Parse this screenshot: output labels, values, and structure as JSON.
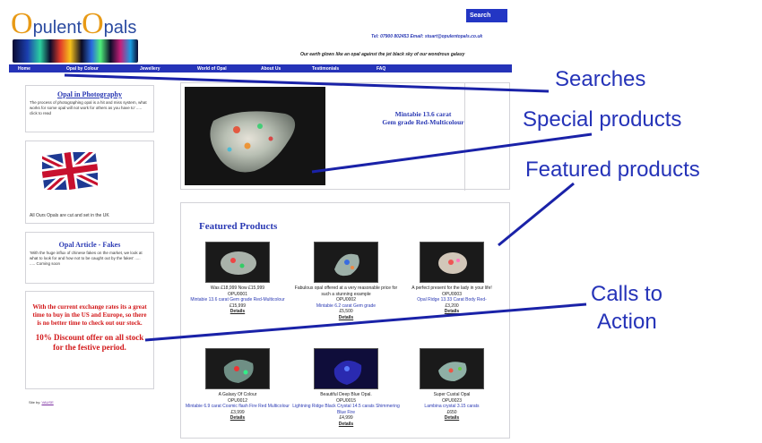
{
  "header": {
    "logo_text_1": "O",
    "logo_text_2": "pulent",
    "logo_text_3": "O",
    "logo_text_4": "pals",
    "search_label": "Search",
    "contact": "Tel: 07900 802453  Email: stuart@opulentopals.co.uk",
    "tagline": "Our earth glows like an opal against the jet black sky of our wondrous galaxy"
  },
  "nav": {
    "items": [
      "Home",
      "Opal by Colour",
      "Jewellery",
      "World of Opal",
      "About Us",
      "Testimonials",
      "FAQ"
    ]
  },
  "sidebar": {
    "photo_title": "Opal in Photography",
    "photo_text": "The process of photographing opal is a hit and miss system, what works for some opal will not work for others as you have to' ..... click to read",
    "flag_caption": "All Ours Opals are cut  and set in the UK",
    "article_title": "Opal Article - Fakes",
    "article_text": "'With the huge influx of chinese fakes on the market, we look at what to look for and how not to be caught out by the fakes' .....",
    "article_more": "..... Coming soon",
    "promo_text": "With the current exchange rates its a great time to buy in the US and Europe, so there is no better time to check out our stock.",
    "promo_offer": "10% Discount offer on all stock for the festive period.",
    "site_by_label": "Site by:",
    "site_by_link": "VAUSE"
  },
  "special": {
    "title_line_1": "Mintabie 13.6 carat",
    "title_line_2": "Gem grade Red-Multicolour"
  },
  "featured": {
    "title": "Featured Products",
    "products": [
      {
        "desc": "Was £18,999 Now £15,999",
        "code": "OPU0001",
        "name": "Mintabie 13.6 carat Gem grade Red-Multicolour",
        "price": "£15,999",
        "details": "Details"
      },
      {
        "desc": "Fabulous opal offered at a very reasonable price for such a stunning example",
        "code": "OPU0002",
        "name": "Mintabie 6.2 carat Gem grade",
        "price": "£5,500",
        "details": "Details"
      },
      {
        "desc": "A perfect present for the lady in your life!",
        "code": "OPU0003",
        "name": "Opal Ridge 13.33 Carat Body Red-",
        "price": "£3,200",
        "details": "Details"
      },
      {
        "desc": "A Galaxy Of Colour",
        "code": "OPU0012",
        "name": "Mintabie 6.9 carat Cosmic flash Fire Red Multicolour",
        "price": "£3,999",
        "details": "Details"
      },
      {
        "desc": "Beautiful Deep Blue Opal.",
        "code": "OPU0015",
        "name": "Lightning Ridge Black Crystal 14.5 carats Shimmering Blue Fire",
        "price": "£4,999",
        "details": "Details"
      },
      {
        "desc": "Super Custal Opal",
        "code": "OPU0023",
        "name": "Lambina crystal 3.15 carats",
        "price": "£650",
        "details": "Details"
      }
    ]
  },
  "annotations": {
    "searches": "Searches",
    "special": "Special products",
    "featured": "Featured products",
    "calls_1": "Calls to",
    "calls_2": "Action"
  },
  "colors": {
    "nav_blue": "#2533b8",
    "link_blue": "#2b3ab4",
    "promo_red": "#d2181a",
    "logo_orange": "#e89a16"
  }
}
